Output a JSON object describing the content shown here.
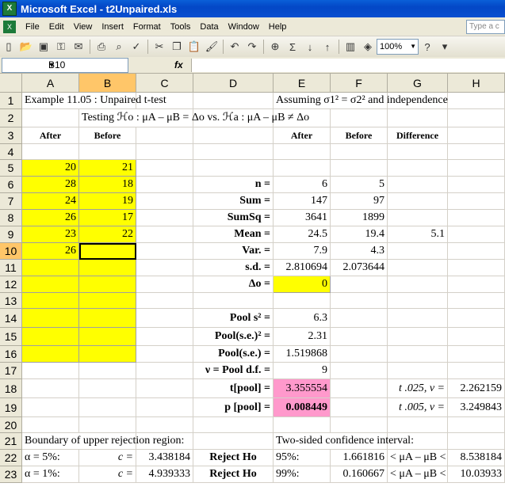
{
  "window": {
    "title": "Microsoft Excel - t2Unpaired.xls"
  },
  "menu": [
    "File",
    "Edit",
    "View",
    "Insert",
    "Format",
    "Tools",
    "Data",
    "Window",
    "Help"
  ],
  "help_placeholder": "Type a c",
  "toolbar": {
    "zoom": "100%"
  },
  "formula_bar": {
    "name_box": "B10",
    "fx": "fx",
    "content": ""
  },
  "columns": [
    "A",
    "B",
    "C",
    "D",
    "E",
    "F",
    "G",
    "H"
  ],
  "rows": [
    "1",
    "2",
    "3",
    "4",
    "5",
    "6",
    "7",
    "8",
    "9",
    "10",
    "11",
    "12",
    "13",
    "14",
    "15",
    "16",
    "17",
    "18",
    "19",
    "20",
    "21",
    "22",
    "23"
  ],
  "cells": {
    "A1": "Example 11.05 :  Unpaired t-test",
    "E1": "Assuming σ1² = σ2² and independence",
    "B2": "Testing  ℋo : μA – μB = Δo   vs.  ℋa : μA – μB ≠ Δo",
    "A3": "After",
    "B3": "Before",
    "E3": "After",
    "F3": "Before",
    "G3": "Difference",
    "A5": "20",
    "B5": "21",
    "A6": "28",
    "B6": "18",
    "D6": "n =",
    "E6": "6",
    "F6": "5",
    "A7": "24",
    "B7": "19",
    "D7": "Sum =",
    "E7": "147",
    "F7": "97",
    "A8": "26",
    "B8": "17",
    "D8": "SumSq =",
    "E8": "3641",
    "F8": "1899",
    "A9": "23",
    "B9": "22",
    "D9": "Mean =",
    "E9": "24.5",
    "F9": "19.4",
    "G9": "5.1",
    "A10": "26",
    "D10": "Var. =",
    "E10": "7.9",
    "F10": "4.3",
    "D11": "s.d. =",
    "E11": "2.810694",
    "F11": "2.073644",
    "D12": "Δo =",
    "E12": "0",
    "D14": "Pool s² =",
    "E14": "6.3",
    "D15": "Pool(s.e.)² =",
    "E15": "2.31",
    "D16": "Pool(s.e.) =",
    "E16": "1.519868",
    "D17": "ν = Pool d.f. =",
    "E17": "9",
    "D18": "t[pool] =",
    "E18": "3.355554",
    "G18": "t .025, ν =",
    "H18": "2.262159",
    "D19": "p [pool] =",
    "E19": "0.008449",
    "G19": "t .005, ν =",
    "H19": "3.249843",
    "A21": "Boundary of upper rejection region:",
    "E21": "Two-sided confidence interval:",
    "A22": "α = 5%:",
    "B22": "c =",
    "C22": "3.438184",
    "D22": "Reject Ho",
    "E22": "95%:",
    "F22": "1.661816",
    "G22": "< μA – μB <",
    "H22": "8.538184",
    "A23": "α = 1%:",
    "B23": "c =",
    "C23": "4.939333",
    "D23": "Reject Ho",
    "E23": "99%:",
    "F23": "0.160667",
    "G23": "< μA – μB <",
    "H23": "10.03933"
  },
  "colors": {
    "input": "#ffff00",
    "result": "#ff99cc",
    "selection": "#ffc669"
  }
}
